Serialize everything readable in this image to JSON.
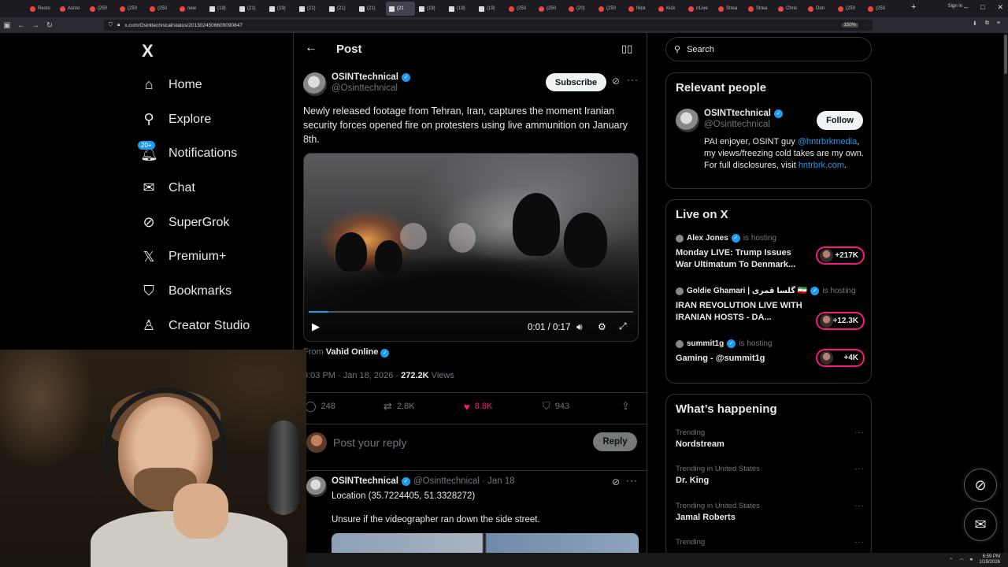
{
  "browser": {
    "tabs": [
      "Resto",
      "Asmo",
      "(250",
      "(250",
      "(250",
      "new",
      "(19)",
      "(21)",
      "(19)",
      "(21)",
      "(21)",
      "(21)",
      "(21",
      "(19)",
      "(19)",
      "(19)",
      "(250",
      "(250",
      "(20)",
      "(250",
      "Nick",
      "Kick",
      "r/Live",
      "Strea",
      "Strea",
      "Chris",
      "Don",
      "(250",
      "(250"
    ],
    "url": "x.com/Osinttechnical/status/2013024506609090847",
    "zoom": "150%",
    "sign_in": "Sign in"
  },
  "nav": {
    "logo": "X",
    "items": [
      {
        "label": "Home",
        "icon": "home-icon",
        "glyph": "⌂"
      },
      {
        "label": "Explore",
        "icon": "search-icon",
        "glyph": "⚲"
      },
      {
        "label": "Notifications",
        "icon": "bell-icon",
        "glyph": "🔔︎",
        "badge": "20+"
      },
      {
        "label": "Chat",
        "icon": "envelope-icon",
        "glyph": "✉"
      },
      {
        "label": "SuperGrok",
        "icon": "grok-icon",
        "glyph": "⊘"
      },
      {
        "label": "Premium+",
        "icon": "x-logo-icon",
        "glyph": "𝕏"
      },
      {
        "label": "Bookmarks",
        "icon": "bookmark-icon",
        "glyph": "⛉"
      },
      {
        "label": "Creator Studio",
        "icon": "creator-icon",
        "glyph": "♙"
      }
    ]
  },
  "post": {
    "header_title": "Post",
    "author_name": "OSINTtechnical",
    "author_handle": "@Osinttechnical",
    "subscribe_label": "Subscribe",
    "text": "Newly released footage from Tehran, Iran, captures the moment Iranian security forces opened fire on protesters using live ammunition on January 8th.",
    "video_time": "0:01 / 0:17",
    "video_progress": 0.06,
    "from_label": "From",
    "from_source": "Vahid Online",
    "timestamp": "6:03 PM · Jan 18, 2026 · ",
    "views_count": "272.2K",
    "views_label": " Views",
    "replies": "248",
    "reposts": "2.8K",
    "likes": "8.8K",
    "bookmarks": "943",
    "reply_placeholder": "Post your reply",
    "reply_button": "Reply"
  },
  "reply_post": {
    "author_name": "OSINTtechnical",
    "handle_time": "@Osinttechnical · Jan 18",
    "line1": "Location (35.7224405, 51.3328272)",
    "line2": "Unsure if the videographer ran down the side street."
  },
  "sidebar": {
    "search_placeholder": "Search",
    "relevant_title": "Relevant people",
    "person_name": "OSINTtechnical",
    "person_handle": "@Osinttechnical",
    "follow_label": "Follow",
    "bio_pre": "PAI enjoyer, OSINT guy ",
    "bio_mention": "@hntrbrkmedia",
    "bio_mid": ", my views/freezing cold takes are my own. For full disclosures, visit ",
    "bio_link": "hntrbrk.com",
    "bio_end": ".",
    "live_title": "Live on X",
    "live": [
      {
        "host": "Alex Jones",
        "hosting": "is hosting",
        "title": "Monday LIVE: Trump Issues War Ultimatum To Denmark...",
        "count": "+217K"
      },
      {
        "host": "Goldie Ghamari | گلسا قمری 🇮🇷",
        "hosting": "is hosting",
        "title": "IRAN REVOLUTION LIVE WITH IRANIAN HOSTS - DA...",
        "count": "+12.3K"
      },
      {
        "host": "summit1g",
        "hosting": "is hosting",
        "title": "Gaming - @summit1g",
        "count": "+4K"
      }
    ],
    "happening_title": "What’s happening",
    "trends": [
      {
        "context": "Trending",
        "name": "Nordstream"
      },
      {
        "context": "Trending in United States",
        "name": "Dr. King"
      },
      {
        "context": "Trending in United States",
        "name": "Jamal Roberts"
      },
      {
        "context": "Trending",
        "name": ""
      }
    ]
  },
  "taskbar": {
    "time": "6:59 PM",
    "date": "1/19/2026"
  }
}
